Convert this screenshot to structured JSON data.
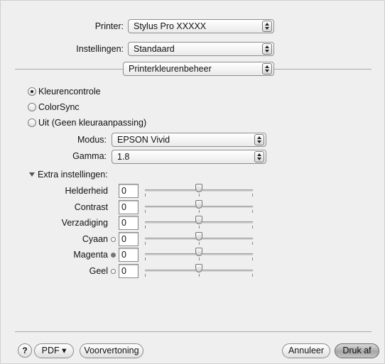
{
  "header": {
    "printer_label": "Printer:",
    "printer_value": "Stylus Pro XXXXX",
    "settings_label": "Instellingen:",
    "settings_value": "Standaard",
    "panel_value": "Printerkleurenbeheer"
  },
  "color_mode": {
    "options": [
      {
        "label": "Kleurencontrole",
        "selected": true
      },
      {
        "label": "ColorSync",
        "selected": false
      },
      {
        "label": "Uit (Geen kleuraanpassing)",
        "selected": false
      }
    ],
    "mode_label": "Modus:",
    "mode_value": "EPSON Vivid",
    "gamma_label": "Gamma:",
    "gamma_value": "1.8"
  },
  "extra": {
    "disclosure_label": "Extra instellingen:",
    "sliders": [
      {
        "label": "Helderheid",
        "value": "0",
        "color_dot": "",
        "position": 0.5
      },
      {
        "label": "Contrast",
        "value": "0",
        "color_dot": "",
        "position": 0.5
      },
      {
        "label": "Verzadiging",
        "value": "0",
        "color_dot": "",
        "position": 0.5
      },
      {
        "label": "Cyaan",
        "value": "0",
        "color_dot": "cyan-dot-icon",
        "position": 0.5
      },
      {
        "label": "Magenta",
        "value": "0",
        "color_dot": "magenta-dot-icon",
        "position": 0.5
      },
      {
        "label": "Geel",
        "value": "0",
        "color_dot": "yellow-dot-icon",
        "position": 0.5
      }
    ]
  },
  "footer": {
    "help_label": "?",
    "pdf_label": "PDF ▾",
    "preview_label": "Voorvertoning",
    "cancel_label": "Annuleer",
    "print_label": "Druk af"
  },
  "colors": {
    "background": "#efefef",
    "default_button": "#a7a7a7"
  }
}
